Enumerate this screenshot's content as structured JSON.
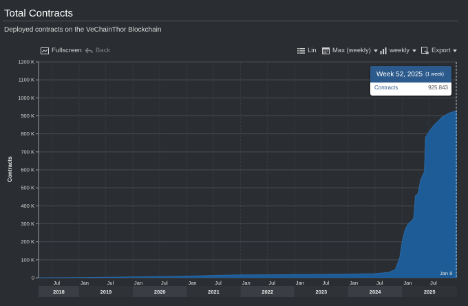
{
  "header": {
    "title": "Total Contracts",
    "subtitle": "Deployed contracts on the VeChainThor Blockchain"
  },
  "toolbar": {
    "fullscreen_label": "Fullscreen",
    "back_label": "Back",
    "scale_label": "Lin",
    "range_label": "Max (weekly)",
    "interval_label": "weekly",
    "export_label": "Export"
  },
  "tooltip": {
    "title": "Week 52, 2025",
    "period": "(1 week)",
    "series_label": "Contracts",
    "series_value": "925.843"
  },
  "crosshair_label": "Jan 8",
  "colors": {
    "background": "#2a2d31",
    "area_fill": "#1d5c97",
    "area_line": "#2a6aa8",
    "crosshair": "#bfc3c8",
    "tooltip_header": "#2c5a8c"
  },
  "chart_data": {
    "type": "area",
    "title": "Total Contracts",
    "subtitle": "Deployed contracts on the VeChainThor Blockchain",
    "ylabel": "Contracts",
    "xlabel": "",
    "ylim": [
      0,
      1200000
    ],
    "yticks": [
      0,
      100000,
      200000,
      300000,
      400000,
      500000,
      600000,
      700000,
      800000,
      900000,
      1000000,
      1100000,
      1200000
    ],
    "ytick_labels": [
      "0",
      "100 K",
      "200 K",
      "300 K",
      "400 K",
      "500 K",
      "600 K",
      "700 K",
      "800 K",
      "900 K",
      "1000 K",
      "1100 K",
      "1200 K"
    ],
    "xlim": [
      "2018-04-01",
      "2026-01-08"
    ],
    "xticks": [
      {
        "date": "2018-07-01",
        "label": "Jul"
      },
      {
        "date": "2019-01-01",
        "label": "Jan"
      },
      {
        "date": "2019-07-01",
        "label": "Jul"
      },
      {
        "date": "2020-01-01",
        "label": "Jan"
      },
      {
        "date": "2020-07-01",
        "label": "Jul"
      },
      {
        "date": "2021-01-01",
        "label": "Jan"
      },
      {
        "date": "2021-07-01",
        "label": "Jul"
      },
      {
        "date": "2022-01-01",
        "label": "Jan"
      },
      {
        "date": "2022-07-01",
        "label": "Jul"
      },
      {
        "date": "2023-01-01",
        "label": "Jan"
      },
      {
        "date": "2023-07-01",
        "label": "Jul"
      },
      {
        "date": "2024-01-01",
        "label": "Jan"
      },
      {
        "date": "2024-07-01",
        "label": "Jul"
      },
      {
        "date": "2025-01-01",
        "label": "Jan"
      },
      {
        "date": "2025-07-01",
        "label": "Jul"
      }
    ],
    "year_bands": [
      {
        "label": "2018",
        "start": "2018-04-01",
        "end": "2019-01-01"
      },
      {
        "label": "2019",
        "start": "2019-01-01",
        "end": "2020-01-01"
      },
      {
        "label": "2020",
        "start": "2020-01-01",
        "end": "2021-01-01"
      },
      {
        "label": "2021",
        "start": "2021-01-01",
        "end": "2022-01-01"
      },
      {
        "label": "2022",
        "start": "2022-01-01",
        "end": "2023-01-01"
      },
      {
        "label": "2023",
        "start": "2023-01-01",
        "end": "2024-01-01"
      },
      {
        "label": "2024",
        "start": "2024-01-01",
        "end": "2025-01-01"
      },
      {
        "label": "2025",
        "start": "2025-01-01",
        "end": "2026-01-08"
      }
    ],
    "grid": true,
    "legend": "none",
    "series": [
      {
        "name": "Contracts",
        "points": [
          [
            "2018-04-01",
            0
          ],
          [
            "2018-10-01",
            500
          ],
          [
            "2019-04-01",
            2000
          ],
          [
            "2019-10-01",
            4000
          ],
          [
            "2020-04-01",
            6000
          ],
          [
            "2020-10-01",
            8000
          ],
          [
            "2021-04-01",
            11000
          ],
          [
            "2021-07-01",
            13000
          ],
          [
            "2021-10-01",
            15000
          ],
          [
            "2022-01-01",
            16000
          ],
          [
            "2022-07-01",
            17000
          ],
          [
            "2023-01-01",
            18000
          ],
          [
            "2023-07-01",
            19000
          ],
          [
            "2024-01-01",
            21000
          ],
          [
            "2024-07-01",
            23000
          ],
          [
            "2024-10-01",
            30000
          ],
          [
            "2024-11-15",
            45000
          ],
          [
            "2024-12-15",
            110000
          ],
          [
            "2025-01-01",
            200000
          ],
          [
            "2025-01-20",
            265000
          ],
          [
            "2025-02-10",
            300000
          ],
          [
            "2025-03-05",
            315000
          ],
          [
            "2025-03-20",
            330000
          ],
          [
            "2025-04-01",
            455000
          ],
          [
            "2025-04-20",
            470000
          ],
          [
            "2025-05-05",
            540000
          ],
          [
            "2025-05-20",
            570000
          ],
          [
            "2025-06-01",
            590000
          ],
          [
            "2025-06-08",
            780000
          ],
          [
            "2025-07-01",
            810000
          ],
          [
            "2025-08-01",
            845000
          ],
          [
            "2025-09-01",
            870000
          ],
          [
            "2025-10-01",
            895000
          ],
          [
            "2025-11-15",
            915000
          ],
          [
            "2025-12-24",
            925843
          ],
          [
            "2026-01-08",
            926000
          ]
        ]
      }
    ]
  }
}
